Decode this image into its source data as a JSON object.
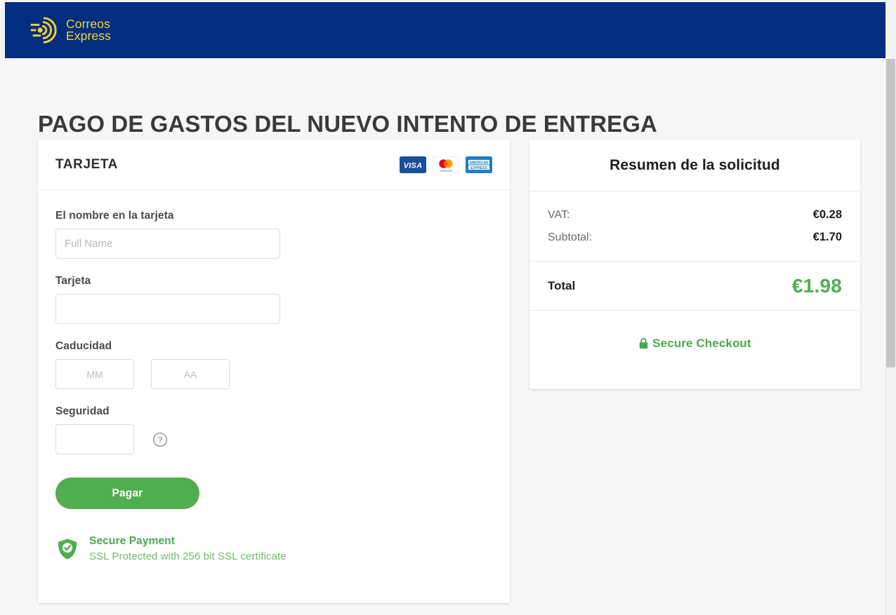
{
  "brand": {
    "logo_icon": "correos-express-logo-icon",
    "line1": "Correos",
    "line2": "Express",
    "header_bg": "#032e7f",
    "logo_color": "#f5d331"
  },
  "page": {
    "title": "PAGO DE GASTOS DEL NUEVO INTENTO DE ENTREGA",
    "background": "#f6f6f7"
  },
  "payment_card": {
    "title": "TARJETA",
    "accepted_cards": [
      {
        "name": "visa",
        "label": "VISA"
      },
      {
        "name": "mastercard",
        "label": "mastercard"
      },
      {
        "name": "american-express",
        "label": "AMERICAN EXPRESS"
      }
    ],
    "fields": {
      "name_label": "El nombre en la tarjeta",
      "name_value": "",
      "name_placeholder": "Full Name",
      "card_label": "Tarjeta",
      "card_value": "",
      "card_placeholder": "",
      "expiry_label": "Caducidad",
      "expiry_month_value": "",
      "expiry_month_placeholder": "MM",
      "expiry_year_value": "",
      "expiry_year_placeholder": "AA",
      "cvv_label": "Seguridad",
      "cvv_value": "",
      "cvv_placeholder": "",
      "cvv_help_icon": "question-circle-icon"
    },
    "submit_label": "Pagar",
    "submit_color": "#4fae4f",
    "secure_payment": {
      "icon": "shield-check-icon",
      "title": "Secure Payment",
      "subtitle": "SSL Protected with 256 bit SSL certificate",
      "color": "#4aa94f"
    }
  },
  "summary_card": {
    "title": "Resumen de la solicitud",
    "lines": [
      {
        "label": "VAT:",
        "value": "€0.28"
      },
      {
        "label": "Subtotal:",
        "value": "€1.70"
      }
    ],
    "total_label": "Total",
    "total_value": "€1.98",
    "total_color": "#4fae4f",
    "secure_checkout": {
      "icon": "lock-icon",
      "label": "Secure Checkout",
      "color": "#4aa94f"
    }
  },
  "scrollbar": {
    "name": "vertical-scrollbar"
  }
}
